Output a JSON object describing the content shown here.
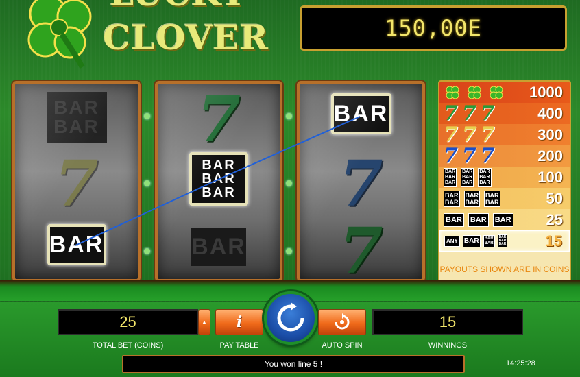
{
  "logo": {
    "line1": "LUCKY",
    "line2": "CLOVER"
  },
  "balance": "150,00E",
  "reels": [
    {
      "top": "BAR BAR",
      "middle": "7",
      "bottom": "BAR"
    },
    {
      "top": "7",
      "middle": "BAR BAR BAR",
      "bottom": "BAR"
    },
    {
      "top": "BAR",
      "middle": "7",
      "bottom": "7"
    }
  ],
  "paytable": {
    "rows": [
      {
        "symbols": "clover clover clover",
        "payout": "1000"
      },
      {
        "symbols": "green-7 green-7 green-7",
        "payout": "400"
      },
      {
        "symbols": "gold-7 gold-7 gold-7",
        "payout": "300"
      },
      {
        "symbols": "blue-7 blue-7 blue-7",
        "payout": "200"
      },
      {
        "symbols": "triple-bar x3",
        "payout": "100"
      },
      {
        "symbols": "double-bar x3",
        "payout": "50"
      },
      {
        "symbols": "bar x3",
        "payout": "25"
      },
      {
        "symbols": "ANY bar",
        "payout": "15",
        "any_label": "ANY"
      }
    ],
    "note": "PAYOUTS SHOWN ARE IN COINS"
  },
  "bar_text": "BAR",
  "seven_text": "7",
  "controls": {
    "total_bet_value": "25",
    "total_bet_label": "TOTAL BET (COINS)",
    "paytable_label": "PAY TABLE",
    "paytable_icon": "i",
    "autospin_label": "AUTO SPIN",
    "winnings_value": "15",
    "winnings_label": "WINNINGS"
  },
  "message": "You won line 5 !",
  "clock": "14:25:28",
  "colors": {
    "balance_text": "#f2e56a",
    "green_seven": "#1f7a3a",
    "gold_seven": "#d8c038",
    "blue_seven": "#1a4ec8",
    "win_line": "#2060d8"
  }
}
